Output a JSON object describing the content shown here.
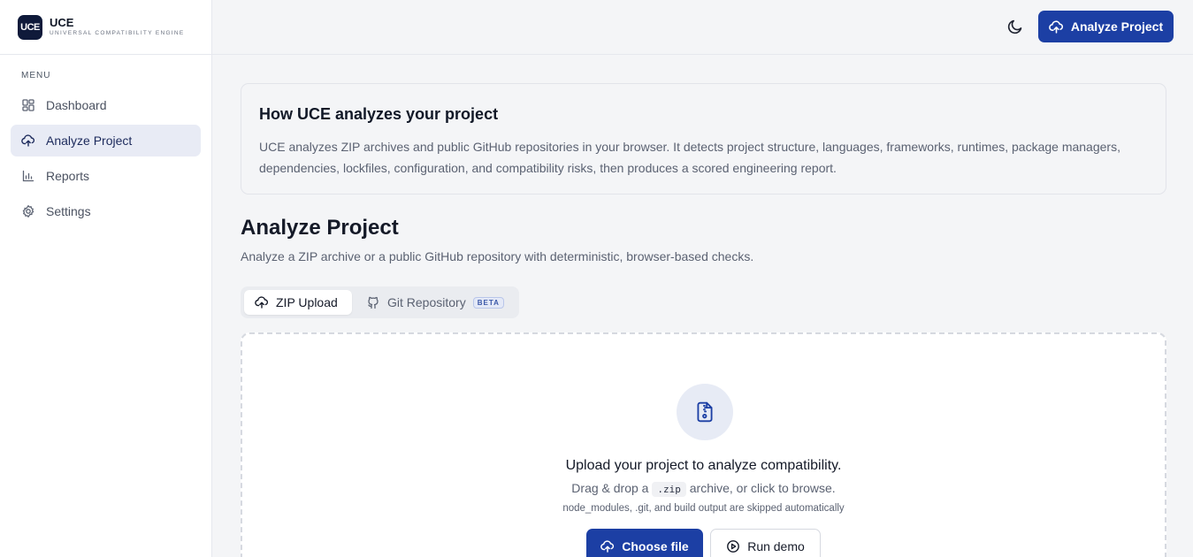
{
  "brand": {
    "logo_text": "UCE",
    "name": "UCE",
    "subtitle": "UNIVERSAL COMPATIBILITY ENGINE"
  },
  "sidebar": {
    "menu_label": "MENU",
    "items": [
      {
        "label": "Dashboard",
        "icon": "dashboard-grid-icon",
        "active": false
      },
      {
        "label": "Analyze Project",
        "icon": "cloud-upload-icon",
        "active": true
      },
      {
        "label": "Reports",
        "icon": "bar-chart-icon",
        "active": false
      },
      {
        "label": "Settings",
        "icon": "gear-icon",
        "active": false
      }
    ]
  },
  "header": {
    "theme_icon": "moon-icon",
    "analyze_button_label": "Analyze Project"
  },
  "info": {
    "title": "How UCE analyzes your project",
    "body": "UCE analyzes ZIP archives and public GitHub repositories in your browser. It detects project structure, languages, frameworks, runtimes, package managers, dependencies, lockfiles, configuration, and compatibility risks, then produces a scored engineering report."
  },
  "page": {
    "title": "Analyze Project",
    "subtitle": "Analyze a ZIP archive or a public GitHub repository with deterministic, browser-based checks."
  },
  "tabs": [
    {
      "label": "ZIP Upload",
      "icon": "cloud-upload-icon",
      "active": true
    },
    {
      "label": "Git Repository",
      "icon": "github-icon",
      "badge": "BETA",
      "active": false
    }
  ],
  "upload": {
    "icon": "file-zip-icon",
    "title": "Upload your project to analyze compatibility.",
    "line_prefix": "Drag & drop a",
    "line_code": ".zip",
    "line_suffix": "archive, or click to browse.",
    "note": "node_modules, .git, and build output are skipped automatically",
    "choose_label": "Choose file",
    "demo_label": "Run demo"
  },
  "colors": {
    "accent": "#1c3fa4",
    "active_nav_bg": "#e8ebf5",
    "page_bg": "#f4f5f7",
    "logo_bg": "#0f1a3a"
  }
}
